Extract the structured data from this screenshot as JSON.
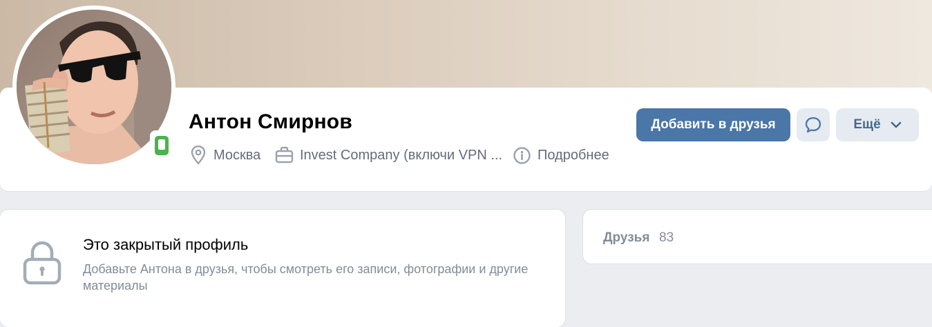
{
  "profile": {
    "name": "Антон Смирнов",
    "city": "Москва",
    "work": "Invest Company (включи VPN ...",
    "details_label": "Подробнее"
  },
  "actions": {
    "add_friend_label": "Добавить в друзья",
    "more_label": "Ещё"
  },
  "closed_profile": {
    "title": "Это закрытый профиль",
    "description": "Добавьте Антона в друзья, чтобы смотреть его записи, фотографии и другие материалы"
  },
  "friends": {
    "label": "Друзья",
    "count": "83"
  },
  "icons": {
    "location": "location-pin-icon",
    "work": "briefcase-icon",
    "info": "info-icon",
    "message": "message-bubble-icon",
    "chevron": "chevron-down-icon",
    "lock": "lock-icon",
    "online": "mobile-online-icon"
  },
  "colors": {
    "primary": "#4a76a8",
    "secondary_bg": "#e5ebf1",
    "online": "#4bb34b",
    "muted_text": "#818c99"
  }
}
